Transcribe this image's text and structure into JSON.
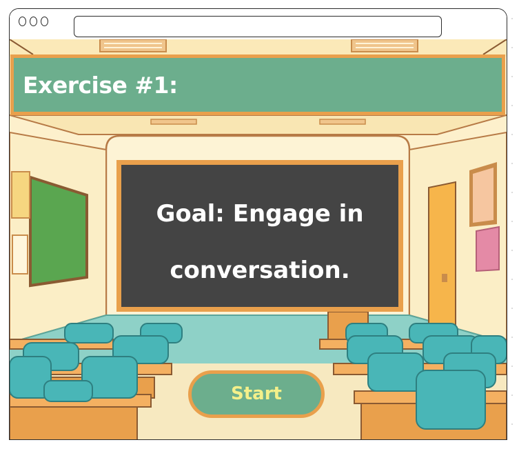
{
  "window": {
    "controls": [
      "close-icon",
      "minimize-icon",
      "maximize-icon"
    ],
    "address": ""
  },
  "colors": {
    "wall": "#fdf0cc",
    "floor": "#f7e9c0",
    "banner": "#6cae8d",
    "border": "#e9a04c",
    "chalkboard": "#444444",
    "button_text": "#f4f08a",
    "chair": "#49b6b7",
    "desk": "#e9a04c",
    "green_board": "#5aa650",
    "door": "#f6b54b"
  },
  "banner": {
    "title": "Exercise #1:"
  },
  "chalkboard": {
    "line1": "Goal: Engage in",
    "line2": "conversation."
  },
  "start_button": {
    "label": "Start"
  }
}
